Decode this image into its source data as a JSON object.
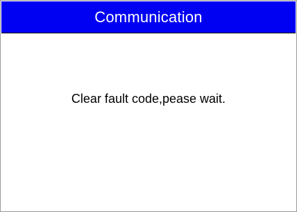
{
  "window": {
    "title": "Communication"
  },
  "main": {
    "message": "Clear fault code,pease wait."
  },
  "colors": {
    "title_bar_bg": "#0000f2",
    "title_text": "#ffffff",
    "background": "#ffffff",
    "message_text": "#000000"
  }
}
